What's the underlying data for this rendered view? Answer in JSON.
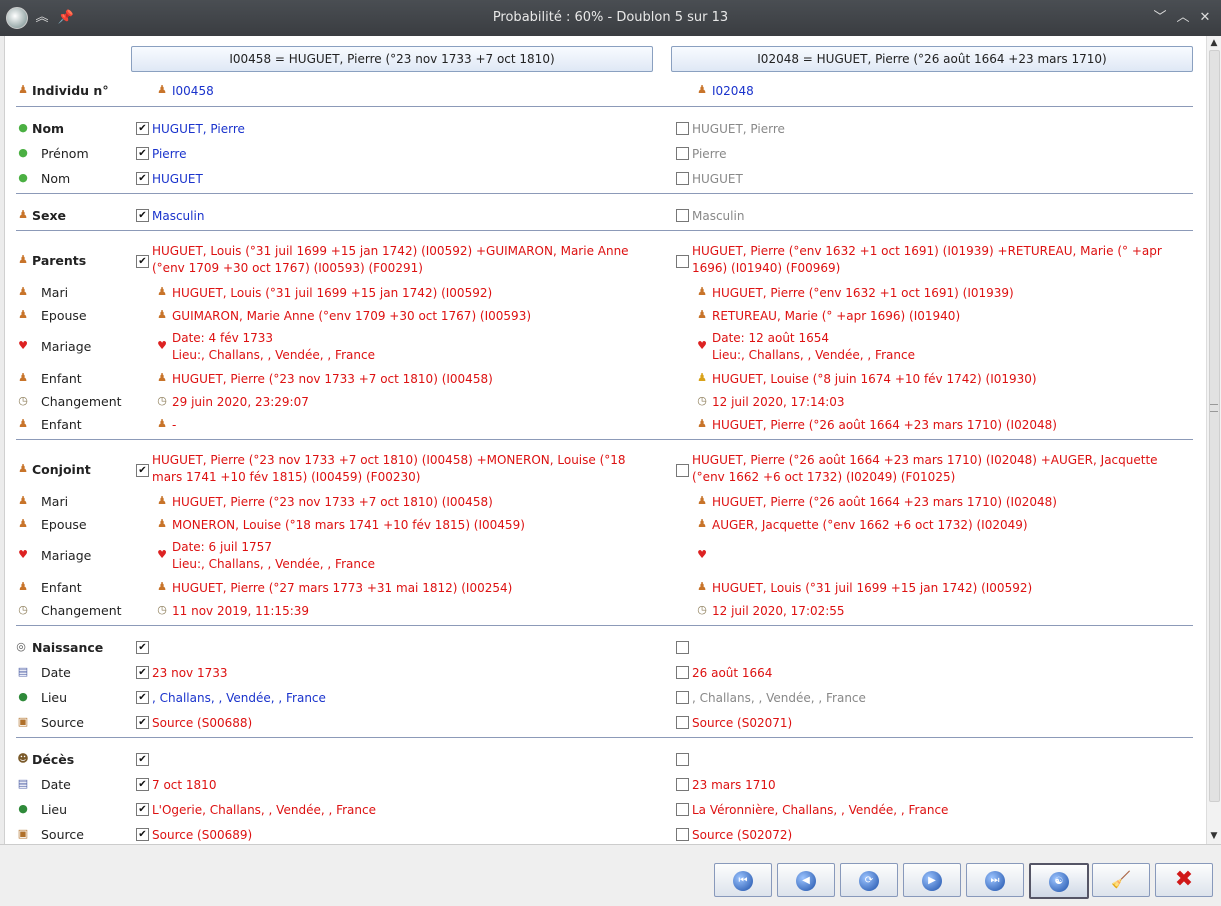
{
  "window": {
    "title": "Probabilité : 60% - Doublon 5 sur 13"
  },
  "columns": {
    "left_header": "I00458 = HUGUET, Pierre (°23 nov 1733 +7 oct 1810)",
    "right_header": "I02048 = HUGUET, Pierre (°26 août 1664 +23 mars 1710)"
  },
  "rows": {
    "individu": {
      "label": "Individu n°",
      "left": "I00458",
      "right": "I02048"
    },
    "nom": {
      "label": "Nom",
      "left": "HUGUET, Pierre",
      "right": "HUGUET, Pierre"
    },
    "prenom": {
      "label": "Prénom",
      "left": "Pierre",
      "right": "Pierre"
    },
    "nom2": {
      "label": "Nom",
      "left": "HUGUET",
      "right": "HUGUET"
    },
    "sexe": {
      "label": "Sexe",
      "left": "Masculin",
      "right": "Masculin"
    },
    "parents": {
      "label": "Parents",
      "left": "HUGUET, Louis (°31 juil 1699 +15 jan 1742) (I00592) +GUIMARON, Marie Anne (°env 1709 +30 oct 1767) (I00593) (F00291)",
      "right": "HUGUET, Pierre (°env 1632 +1 oct 1691) (I01939) +RETUREAU, Marie (° +apr 1696) (I01940) (F00969)"
    },
    "p_mari": {
      "label": "Mari",
      "left": "HUGUET, Louis (°31 juil 1699 +15 jan 1742) (I00592)",
      "right": "HUGUET, Pierre (°env 1632 +1 oct 1691) (I01939)"
    },
    "p_epouse": {
      "label": "Epouse",
      "left": "GUIMARON, Marie Anne (°env 1709 +30 oct 1767) (I00593)",
      "right": "RETUREAU, Marie (° +apr 1696) (I01940)"
    },
    "p_mariage": {
      "label": "Mariage",
      "left_date": "Date: 4 fév 1733",
      "left_lieu": "Lieu:, Challans, , Vendée, , France",
      "right_date": "Date: 12 août 1654",
      "right_lieu": "Lieu:, Challans, , Vendée, , France"
    },
    "p_enfant": {
      "label": "Enfant",
      "left": "HUGUET, Pierre (°23 nov 1733 +7 oct 1810) (I00458)",
      "right": "HUGUET, Louise (°8 juin 1674 +10 fév 1742) (I01930)"
    },
    "p_changement": {
      "label": "Changement",
      "left": "29 juin 2020, 23:29:07",
      "right": "12 juil 2020, 17:14:03"
    },
    "p_enfant2": {
      "label": "Enfant",
      "left": "-",
      "right": "HUGUET, Pierre (°26 août 1664 +23 mars 1710) (I02048)"
    },
    "conjoint": {
      "label": "Conjoint",
      "left": "HUGUET, Pierre (°23 nov 1733 +7 oct 1810) (I00458) +MONERON, Louise (°18 mars 1741 +10 fév 1815) (I00459) (F00230)",
      "right": "HUGUET, Pierre (°26 août 1664 +23 mars 1710) (I02048) +AUGER, Jacquette (°env 1662 +6 oct 1732) (I02049) (F01025)"
    },
    "c_mari": {
      "label": "Mari",
      "left": "HUGUET, Pierre (°23 nov 1733 +7 oct 1810) (I00458)",
      "right": "HUGUET, Pierre (°26 août 1664 +23 mars 1710) (I02048)"
    },
    "c_epouse": {
      "label": "Epouse",
      "left": "MONERON, Louise (°18 mars 1741 +10 fév 1815) (I00459)",
      "right": "AUGER, Jacquette (°env 1662 +6 oct 1732) (I02049)"
    },
    "c_mariage": {
      "label": "Mariage",
      "left_date": "Date: 6 juil 1757",
      "left_lieu": "Lieu:, Challans, , Vendée, , France"
    },
    "c_enfant": {
      "label": "Enfant",
      "left": "HUGUET, Pierre (°27 mars 1773 +31 mai 1812) (I00254)",
      "right": "HUGUET, Louis (°31 juil 1699 +15 jan 1742) (I00592)"
    },
    "c_changement": {
      "label": "Changement",
      "left": "11 nov 2019, 11:15:39",
      "right": "12 juil 2020, 17:02:55"
    },
    "naissance": {
      "label": "Naissance"
    },
    "n_date": {
      "label": "Date",
      "left": "23 nov 1733",
      "right": "26 août 1664"
    },
    "n_lieu": {
      "label": "Lieu",
      "left": ", Challans, , Vendée, , France",
      "right": ", Challans, , Vendée, , France"
    },
    "n_source": {
      "label": "Source",
      "left": "Source (S00688)",
      "right": "Source (S02071)"
    },
    "deces": {
      "label": "Décès"
    },
    "d_date": {
      "label": "Date",
      "left": "7 oct 1810",
      "right": "23 mars 1710"
    },
    "d_lieu": {
      "label": "Lieu",
      "left": "L'Ogerie, Challans, , Vendée, , France",
      "right": "La Véronnière, Challans, , Vendée, , France"
    },
    "d_source": {
      "label": "Source",
      "left": "Source (S00689)",
      "right": "Source (S02072)"
    }
  },
  "check": "✔",
  "colors": {
    "accent_blue": "#1a33cc",
    "accent_red": "#dd1111",
    "disabled_grey": "#888888",
    "separator": "#8c9ab8"
  },
  "buttons": [
    "first-icon",
    "previous-icon",
    "refresh-icon",
    "next-icon",
    "last-icon",
    "merge-icon",
    "broom-icon",
    "close-icon"
  ]
}
